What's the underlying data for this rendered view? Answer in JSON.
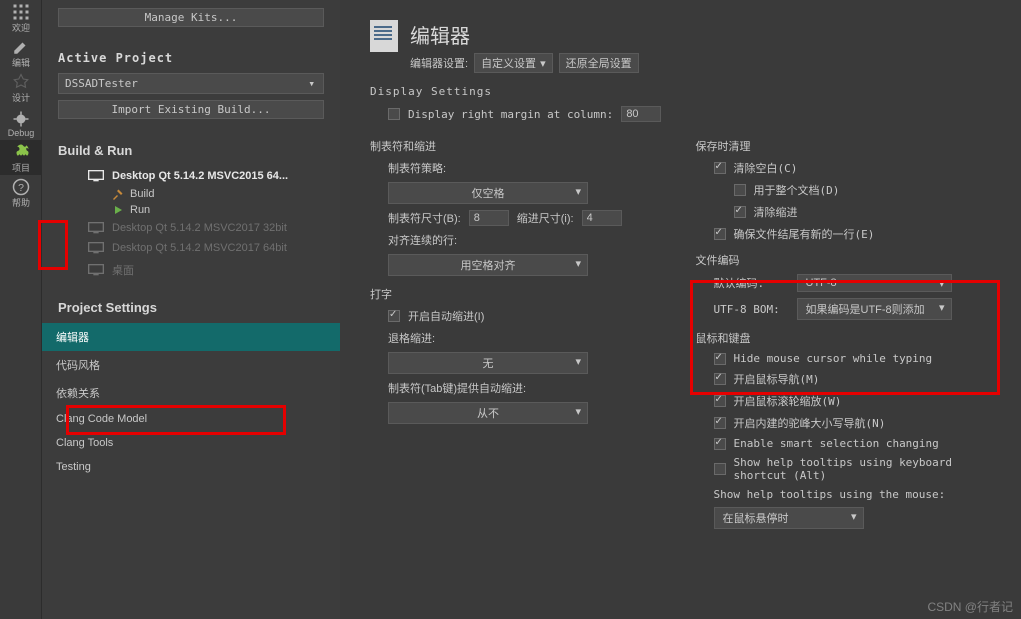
{
  "rail": {
    "welcome": "欢迎",
    "edit": "编辑",
    "design": "设计",
    "debug": "Debug",
    "project": "项目",
    "help": "帮助"
  },
  "panel": {
    "manage_kits": "Manage Kits...",
    "active_project": "Active Project",
    "project_name": "DSSADTester",
    "import_build": "Import Existing Build...",
    "build_run": "Build & Run",
    "kits": [
      {
        "name": "Desktop Qt 5.14.2 MSVC2015 64...",
        "active": true
      },
      {
        "name": "Desktop Qt 5.14.2 MSVC2017 32bit",
        "active": false
      },
      {
        "name": "Desktop Qt 5.14.2 MSVC2017 64bit",
        "active": false
      },
      {
        "name": "桌面",
        "active": false
      }
    ],
    "build_label": "Build",
    "run_label": "Run",
    "project_settings": "Project Settings",
    "ps_items": [
      "编辑器",
      "代码风格",
      "依赖关系",
      "Clang Code Model",
      "Clang Tools",
      "Testing"
    ]
  },
  "content": {
    "title": "编辑器",
    "settings_label": "编辑器设置:",
    "settings_value": "自定义设置",
    "reset_btn": "还原全局设置",
    "display_settings": "Display Settings",
    "margin_label": "Display right margin at column:",
    "margin_value": "80",
    "tabs_title": "制表符和缩进",
    "tab_policy_label": "制表符策略:",
    "tab_policy_value": "仅空格",
    "tab_size_label": "制表符尺寸(B):",
    "tab_size_value": "8",
    "indent_size_label": "缩进尺寸(i):",
    "indent_size_value": "4",
    "align_label": "对齐连续的行:",
    "align_value": "用空格对齐",
    "typing_title": "打字",
    "auto_indent": "开启自动缩进(I)",
    "backspace_label": "退格缩进:",
    "backspace_value": "无",
    "tabkey_label": "制表符(Tab键)提供自动缩进:",
    "tabkey_value": "从不",
    "cleanup_title": "保存时清理",
    "clean_ws": "清除空白(C)",
    "whole_doc": "用于整个文档(D)",
    "clean_indent": "清除缩进",
    "ensure_newline": "确保文件结尾有新的一行(E)",
    "encoding_title": "文件编码",
    "default_enc_label": "默认编码:",
    "default_enc_value": "UTF-8",
    "bom_label": "UTF-8 BOM:",
    "bom_value": "如果编码是UTF-8则添加",
    "mouse_title": "鼠标和键盘",
    "hide_cursor": "Hide mouse cursor while typing",
    "mouse_nav": "开启鼠标导航(M)",
    "scroll_zoom": "开启鼠标滚轮缩放(W)",
    "camel_nav": "开启内建的驼峰大小写导航(N)",
    "smart_sel": "Enable smart selection changing",
    "tooltip_kbd": "Show help tooltips using keyboard shortcut (Alt)",
    "tooltip_mouse_label": "Show help tooltips using the mouse:",
    "tooltip_mouse_value": "在鼠标悬停时"
  },
  "watermark": "CSDN @行者记"
}
